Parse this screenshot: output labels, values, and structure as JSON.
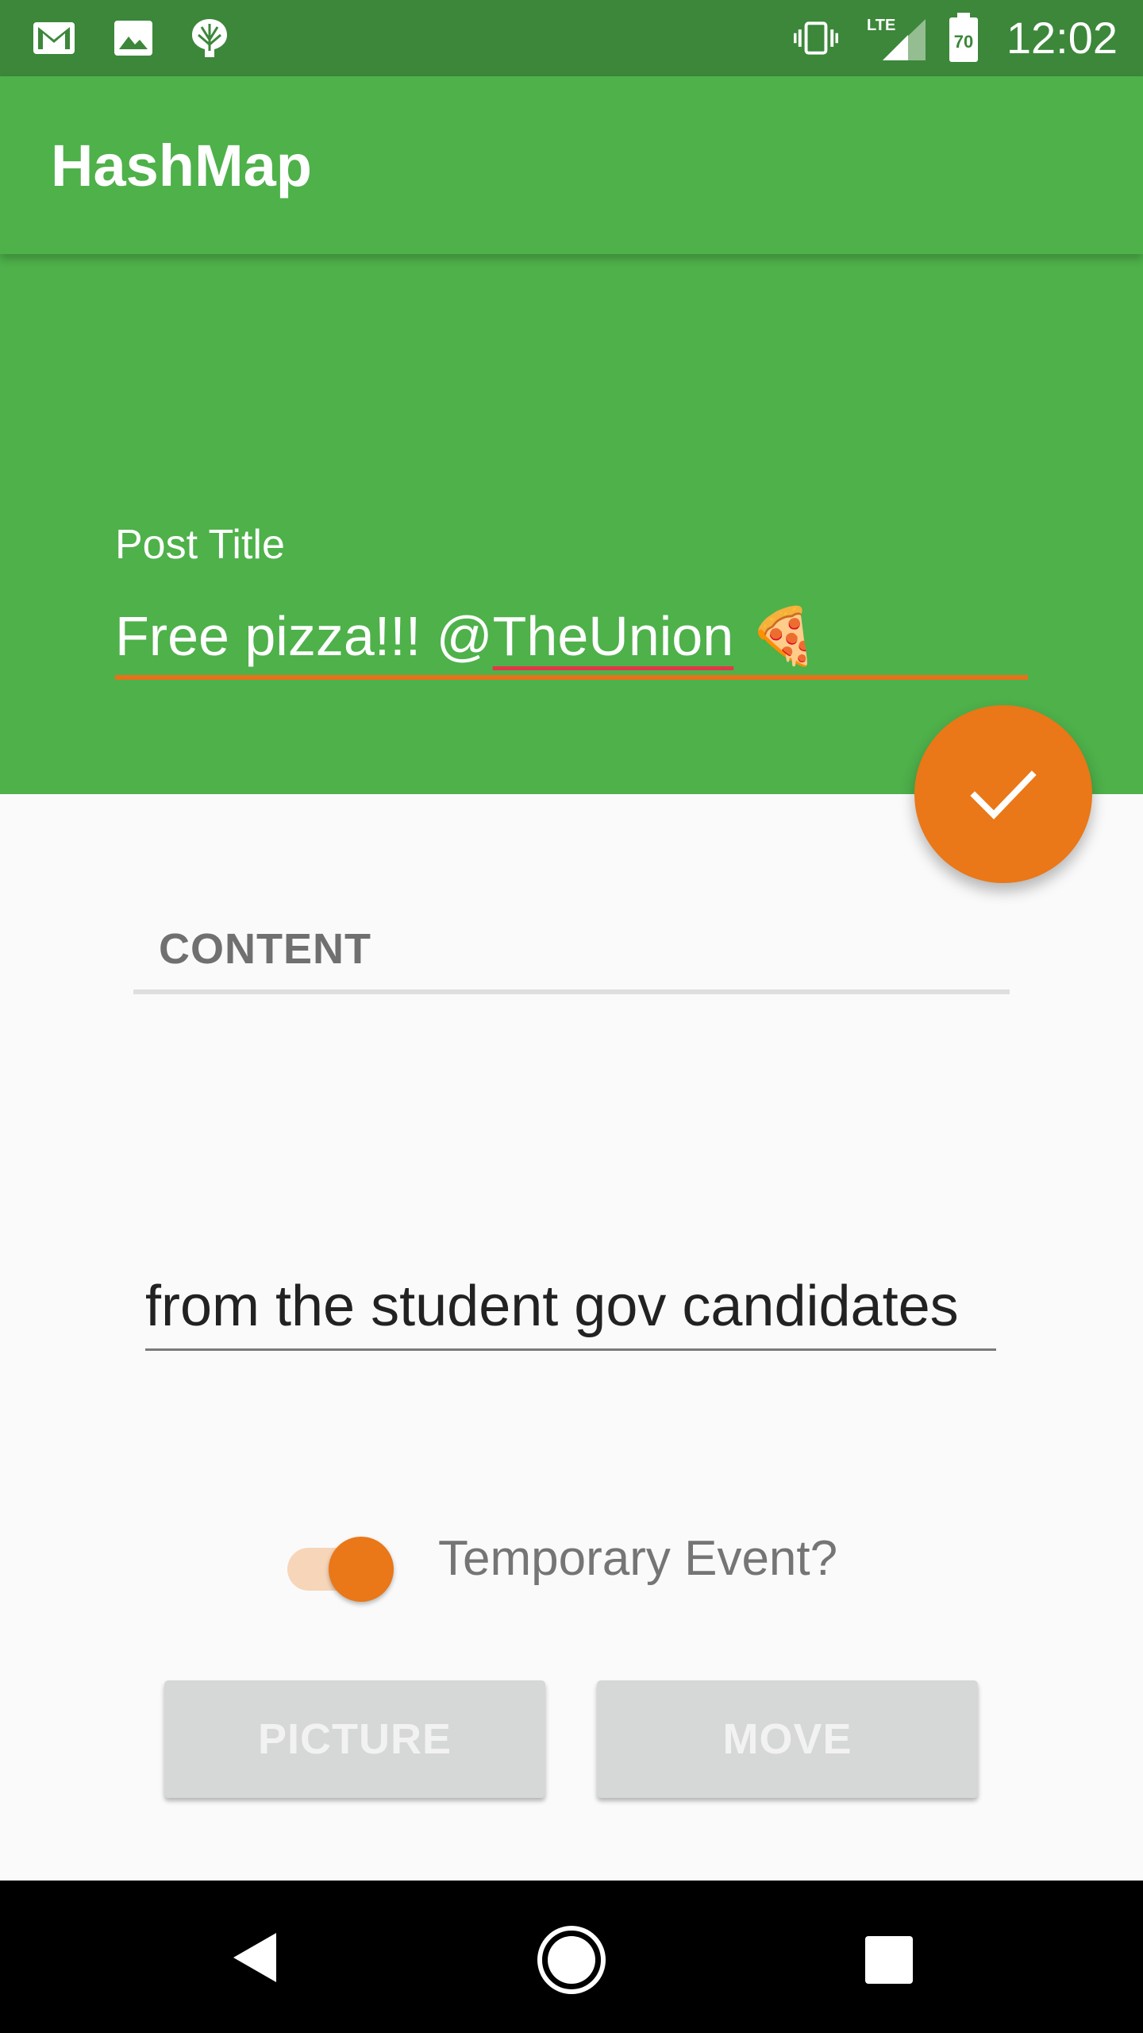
{
  "status_bar": {
    "time": "12:02",
    "battery_level": "70",
    "network": "LTE",
    "icons": [
      "gmail-icon",
      "gallery-icon",
      "app-notification-icon",
      "vibrate-icon",
      "lte-signal-icon",
      "battery-icon"
    ]
  },
  "app_bar": {
    "title": "HashMap"
  },
  "form": {
    "post_title_label": "Post Title",
    "post_title_value_part1": "Free pizza!!! @",
    "post_title_value_part2": "TheUnion",
    "post_title_emoji": "🍕",
    "content_label": "CONTENT",
    "body_value": "from the student gov candidates",
    "temporary_event_label": "Temporary Event?",
    "temporary_event_enabled": true,
    "picture_button": "PICTURE",
    "move_button": "MOVE"
  },
  "fab": {
    "icon": "check-icon"
  },
  "navigation": {
    "back": "back-icon",
    "home": "home-icon",
    "recents": "recents-icon"
  },
  "colors": {
    "primary": "#4eb14a",
    "primary_dark": "#3c873a",
    "accent": "#ea7718"
  }
}
